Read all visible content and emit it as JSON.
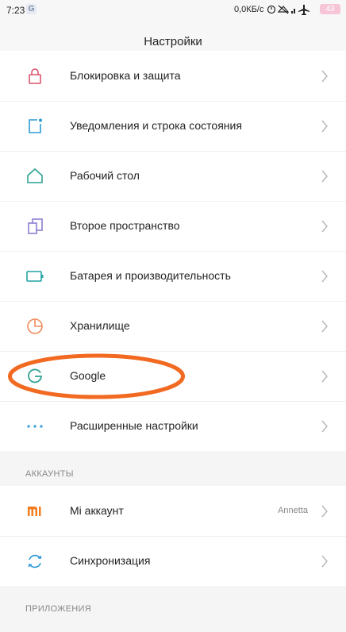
{
  "status_bar": {
    "time": "7:23",
    "app_glyph": "G",
    "network_speed": "0,0КБ/с",
    "battery": "43",
    "icons": [
      "alarm-icon",
      "wifi-off-icon",
      "signal-icon",
      "airplane-icon",
      "battery-icon"
    ]
  },
  "header": {
    "title": "Настройки"
  },
  "system_items": [
    {
      "label": "Блокировка и защита",
      "icon": "lock-icon",
      "color": "#d9536c"
    },
    {
      "label": "Уведомления и строка состояния",
      "icon": "notification-icon",
      "color": "#2e9bd6"
    },
    {
      "label": "Рабочий стол",
      "icon": "home-icon",
      "color": "#2fa391"
    },
    {
      "label": "Второе пространство",
      "icon": "second-space-icon",
      "color": "#8a7fd1"
    },
    {
      "label": "Батарея и производительность",
      "icon": "battery-icon",
      "color": "#22a3a3"
    },
    {
      "label": "Хранилище",
      "icon": "storage-pie-icon",
      "color": "#f08a5d"
    },
    {
      "label": "Google",
      "icon": "google-icon",
      "color": "#2fa391"
    },
    {
      "label": "Расширенные настройки",
      "icon": "more-dots-icon",
      "color": "#2e9bd6"
    }
  ],
  "accounts": {
    "section_title": "АККАУНТЫ",
    "items": [
      {
        "label": "Mi аккаунт",
        "value": "Annetta",
        "icon": "mi-icon",
        "color": "#f47c20"
      },
      {
        "label": "Синхронизация",
        "value": "",
        "icon": "sync-icon",
        "color": "#2e9bd6"
      }
    ]
  },
  "apps": {
    "section_title": "ПРИЛОЖЕНИЯ"
  },
  "annotation": {
    "color": "#f26a21"
  }
}
